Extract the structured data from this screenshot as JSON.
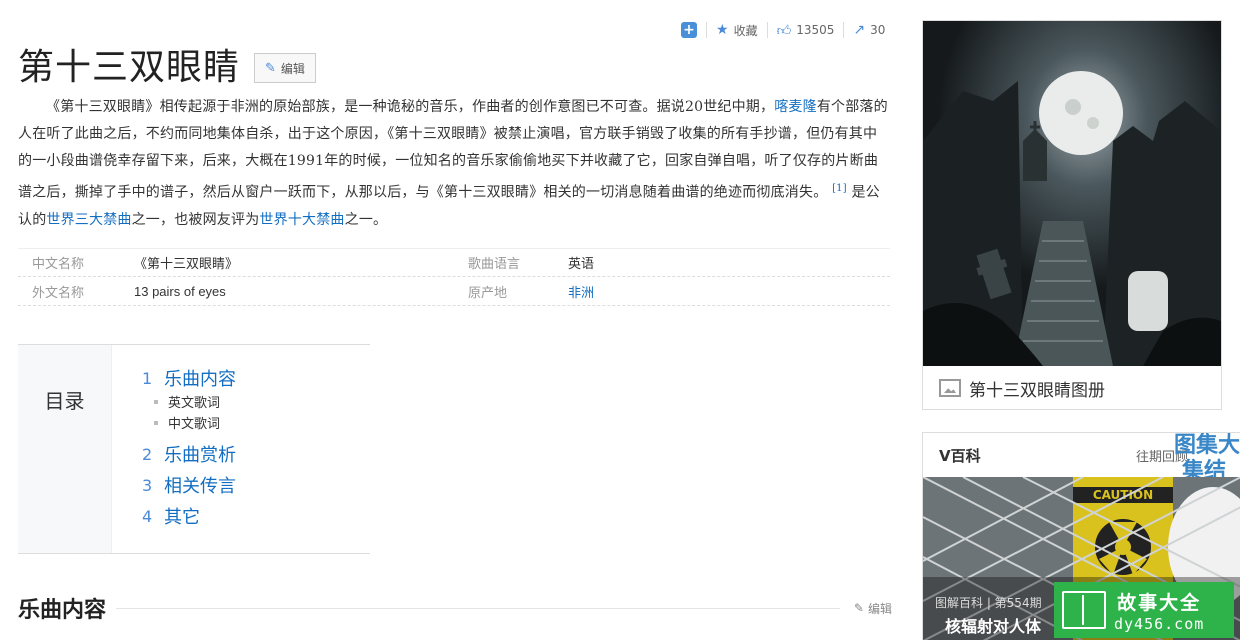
{
  "toolbar": {
    "plus_icon": "plus-icon",
    "collect_label": "收藏",
    "like_count": "13505",
    "share_count": "30"
  },
  "title": "第十三双眼睛",
  "edit_label": "编辑",
  "summary": {
    "p1": "《第十三双眼睛》相传起源于非洲的原始部族，是一种诡秘的音乐，作曲者的创作意图已不可查。据说20世纪中期，",
    "link1": "喀麦隆",
    "p2": "有个部落的人在听了此曲之后，不约而同地集体自杀，出于这个原因，《第十三双眼睛》被禁止演唱，官方联手销毁了收集的所有手抄谱，但仍有其中的一小段曲谱侥幸存留下来，后来，大概在1991年的时候，一位知名的音乐家偷偷地买下并收藏了它，回家自弹自唱，听了仅存的片断曲谱之后，撕掉了手中的谱子，然后从窗户一跃而下，从那以后，与《第十三双眼睛》相关的一切消息随着曲谱的绝迹而彻底消失。",
    "ref": "[1]",
    "p3": " 是公认的",
    "link2": "世界三大禁曲",
    "p4": "之一，也被网友评为",
    "link3": "世界十大禁曲",
    "p5": "之一。"
  },
  "info": [
    {
      "k1": "中文名称",
      "v1": "《第十三双眼睛》",
      "k2": "歌曲语言",
      "v2": "英语"
    },
    {
      "k1": "外文名称",
      "v1": "13 pairs of eyes",
      "k2": "原产地",
      "v2": "非洲"
    }
  ],
  "toc": {
    "head": "目录",
    "items": [
      {
        "num": "1",
        "label": "乐曲内容"
      },
      {
        "num": "2",
        "label": "乐曲赏析"
      },
      {
        "num": "3",
        "label": "相关传言"
      },
      {
        "num": "4",
        "label": "其它"
      }
    ],
    "sub": [
      "英文歌词",
      "中文歌词"
    ]
  },
  "section": {
    "title": "乐曲内容",
    "edit_label": "编辑"
  },
  "album": {
    "caption": "第十三双眼睛图册"
  },
  "vbaike": {
    "title": "V百科",
    "more": "往期回顾",
    "overlay_l1": "图集大",
    "overlay_l2": "集结号",
    "tag": "图解百科 | 第554期",
    "caption": "核辐射对人体"
  },
  "watermark": {
    "line1": "故事大全",
    "line2": "dy456.com"
  },
  "colors": {
    "link": "#136ec2",
    "accent": "#4a8ad9",
    "watermark": "#2db34a"
  }
}
